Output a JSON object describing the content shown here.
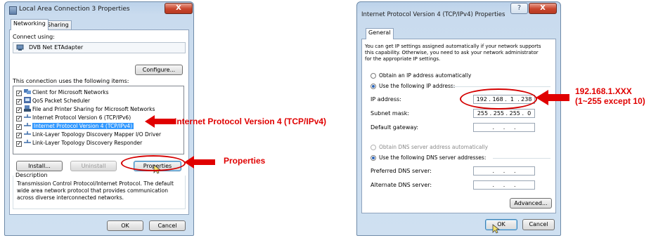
{
  "left_dialog": {
    "title": "Local Area Connection 3 Properties",
    "close_label": "X",
    "tabs": [
      "Networking",
      "Sharing"
    ],
    "connect_using_label": "Connect using:",
    "adapter_name": "DVB Net ETAdapter",
    "configure_label": "Configure...",
    "items_label": "This connection uses the following items:",
    "items": [
      {
        "label": "Client for Microsoft Networks",
        "checked": true,
        "selected": false
      },
      {
        "label": "QoS Packet Scheduler",
        "checked": true,
        "selected": false
      },
      {
        "label": "File and Printer Sharing for Microsoft Networks",
        "checked": true,
        "selected": false
      },
      {
        "label": "Internet Protocol Version 6 (TCP/IPv6)",
        "checked": true,
        "selected": false
      },
      {
        "label": "Internet Protocol Version 4 (TCP/IPv4)",
        "checked": true,
        "selected": true
      },
      {
        "label": "Link-Layer Topology Discovery Mapper I/O Driver",
        "checked": true,
        "selected": false
      },
      {
        "label": "Link-Layer Topology Discovery Responder",
        "checked": true,
        "selected": false
      }
    ],
    "install_label": "Install...",
    "uninstall_label": "Uninstall",
    "properties_label": "Properties",
    "description_label": "Description",
    "description_text": [
      "Transmission Control Protocol/Internet Protocol. The default",
      "wide area network protocol that provides communication",
      "across diverse interconnected networks."
    ],
    "ok_label": "OK",
    "cancel_label": "Cancel"
  },
  "right_dialog": {
    "title": "Internet Protocol Version 4 (TCP/IPv4) Properties",
    "help_label": "?",
    "close_label": "X",
    "tab_general": "General",
    "intro_text": [
      "You can get IP settings assigned automatically if your network supports",
      "this capability. Otherwise, you need to ask your network administrator",
      "for the appropriate IP settings."
    ],
    "obtain_ip_auto": "Obtain an IP address automatically",
    "use_following_ip": "Use the following IP address:",
    "ip_address_label": "IP address:",
    "ip_address_value": "192 . 168 .  1  . 238",
    "subnet_label": "Subnet mask:",
    "subnet_value": "255 . 255 . 255 .  0",
    "gateway_label": "Default gateway:",
    "gateway_value": " .     .     . ",
    "obtain_dns_auto": "Obtain DNS server address automatically",
    "use_following_dns": "Use the following DNS server addresses:",
    "preferred_dns_label": "Preferred DNS server:",
    "preferred_dns_value": " .     .     . ",
    "alternate_dns_label": "Alternate DNS server:",
    "alternate_dns_value": " .     .     . ",
    "advanced_label": "Advanced...",
    "ok_label": "OK",
    "cancel_label": "Cancel"
  },
  "annotations": {
    "ipv4": "Internet Protocol Version 4 (TCP/IPv4)",
    "properties": "Properties",
    "ip_line1": "192.168.1.XXX",
    "ip_line2": "(1~255 except 10)",
    "color": "#e00000"
  }
}
